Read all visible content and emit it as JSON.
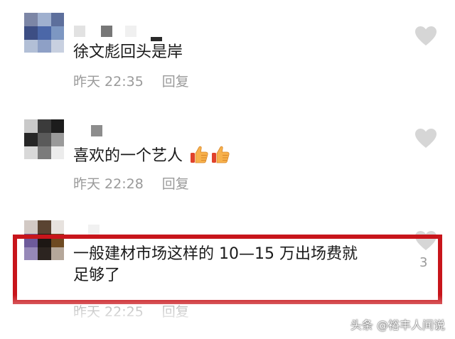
{
  "comments": [
    {
      "text": "徐文彪回头是岸",
      "time": "昨天 22:35",
      "reply_label": "回复"
    },
    {
      "text": "喜欢的一个艺人",
      "emoji": [
        "thumbs-up-icon",
        "thumbs-up-icon"
      ],
      "time": "昨天 22:28",
      "reply_label": "回复"
    },
    {
      "text_line1": "一般建材市场这样的 10—15 万出场费就",
      "text_line2": "足够了",
      "like_count": "3",
      "time": "昨天 22:25",
      "reply_label": "回复"
    }
  ],
  "watermark": "头条 @裕丰人间说",
  "colors": {
    "highlight": "#c8151b",
    "meta_text": "#9a9a9a",
    "heart": "#d6d6d6"
  }
}
